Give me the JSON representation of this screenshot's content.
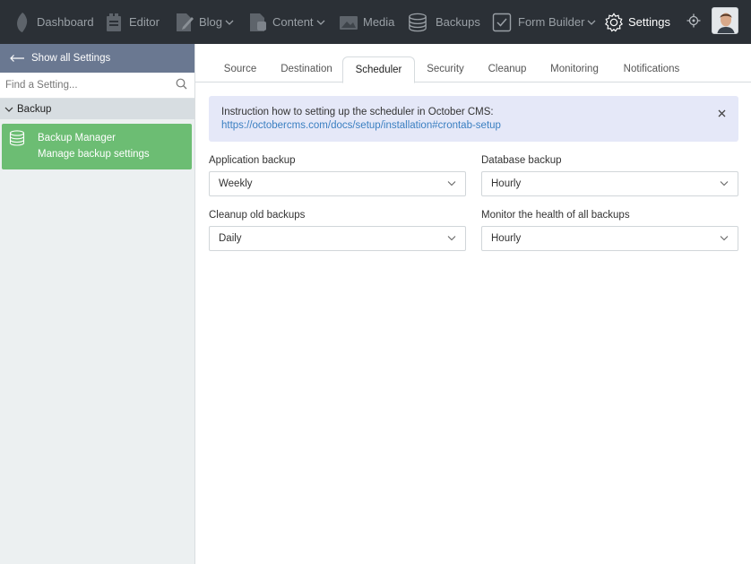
{
  "nav": {
    "items": [
      {
        "label": "Dashboard",
        "icon": "octobercms-leaf-icon"
      },
      {
        "label": "Editor",
        "icon": "editor-icon"
      },
      {
        "label": "Blog",
        "icon": "blog-icon"
      },
      {
        "label": "Content",
        "icon": "content-icon"
      },
      {
        "label": "Media",
        "icon": "media-icon"
      },
      {
        "label": "Backups",
        "icon": "database-icon"
      },
      {
        "label": "Form Builder",
        "icon": "checkbox-icon"
      },
      {
        "label": "Settings",
        "icon": "gear-icon"
      }
    ],
    "active": "Settings"
  },
  "sidebar": {
    "back_label": "Show all Settings",
    "search_placeholder": "Find a Setting...",
    "group_label": "Backup",
    "item_title": "Backup Manager",
    "item_desc": "Manage backup settings"
  },
  "tabs": [
    "Source",
    "Destination",
    "Scheduler",
    "Security",
    "Cleanup",
    "Monitoring",
    "Notifications"
  ],
  "active_tab": "Scheduler",
  "callout": {
    "text": "Instruction how to setting up the scheduler in October CMS:",
    "link": "https://octobercms.com/docs/setup/installation#crontab-setup"
  },
  "fields": {
    "application_backup": {
      "label": "Application backup",
      "value": "Weekly"
    },
    "database_backup": {
      "label": "Database backup",
      "value": "Hourly"
    },
    "cleanup_old_backups": {
      "label": "Cleanup old backups",
      "value": "Daily"
    },
    "monitor_health": {
      "label": "Monitor the health of all backups",
      "value": "Hourly"
    }
  },
  "colors": {
    "topbar": "#2b3036",
    "sidebar_header": "#6a7891",
    "active_item": "#6cbd73",
    "callout_bg": "#e5e8f8",
    "link": "#3a7fc1"
  }
}
